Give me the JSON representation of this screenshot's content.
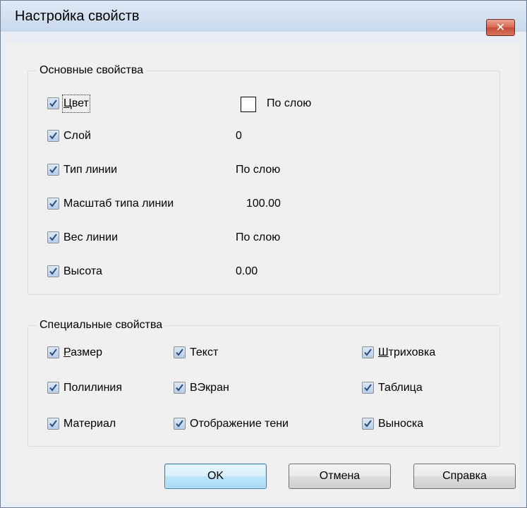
{
  "window": {
    "title": "Настройка свойств",
    "close_label": "✕"
  },
  "basic": {
    "title": "Основные свойства",
    "items": [
      {
        "label_underlined": "Ц",
        "label_rest": "вет",
        "value": "По слою",
        "checked": true
      },
      {
        "label": "Слой",
        "value": "0",
        "checked": true
      },
      {
        "label": "Тип линии",
        "value": "По слою",
        "checked": true
      },
      {
        "label": "Масштаб типа линии",
        "value": "100.00",
        "checked": true
      },
      {
        "label": "Вес линии",
        "value": "По слою",
        "checked": true
      },
      {
        "label": "Высота",
        "value": "0.00",
        "checked": true
      }
    ]
  },
  "special": {
    "title": "Специальные свойства",
    "items": [
      {
        "label_underlined": "Р",
        "label_rest": "азмер",
        "checked": true
      },
      {
        "label": "Текст",
        "checked": true
      },
      {
        "label_underlined": "Ш",
        "label_rest": "триховка",
        "checked": true
      },
      {
        "label": "Полилиния",
        "checked": true
      },
      {
        "label": "ВЭкран",
        "checked": true
      },
      {
        "label": "Таблица",
        "checked": true
      },
      {
        "label": "Материал",
        "checked": true
      },
      {
        "label": "Отображение тени",
        "checked": true
      },
      {
        "label": "Выноска",
        "checked": true
      }
    ]
  },
  "buttons": {
    "ok": "OK",
    "cancel": "Отмена",
    "help": "Справка"
  },
  "colors": {
    "accent": "#3c7fb1",
    "check_mark": "#2a4d7e",
    "close": "#c44d36"
  },
  "icons": {
    "check": "checkmark-icon",
    "close": "close-icon"
  }
}
